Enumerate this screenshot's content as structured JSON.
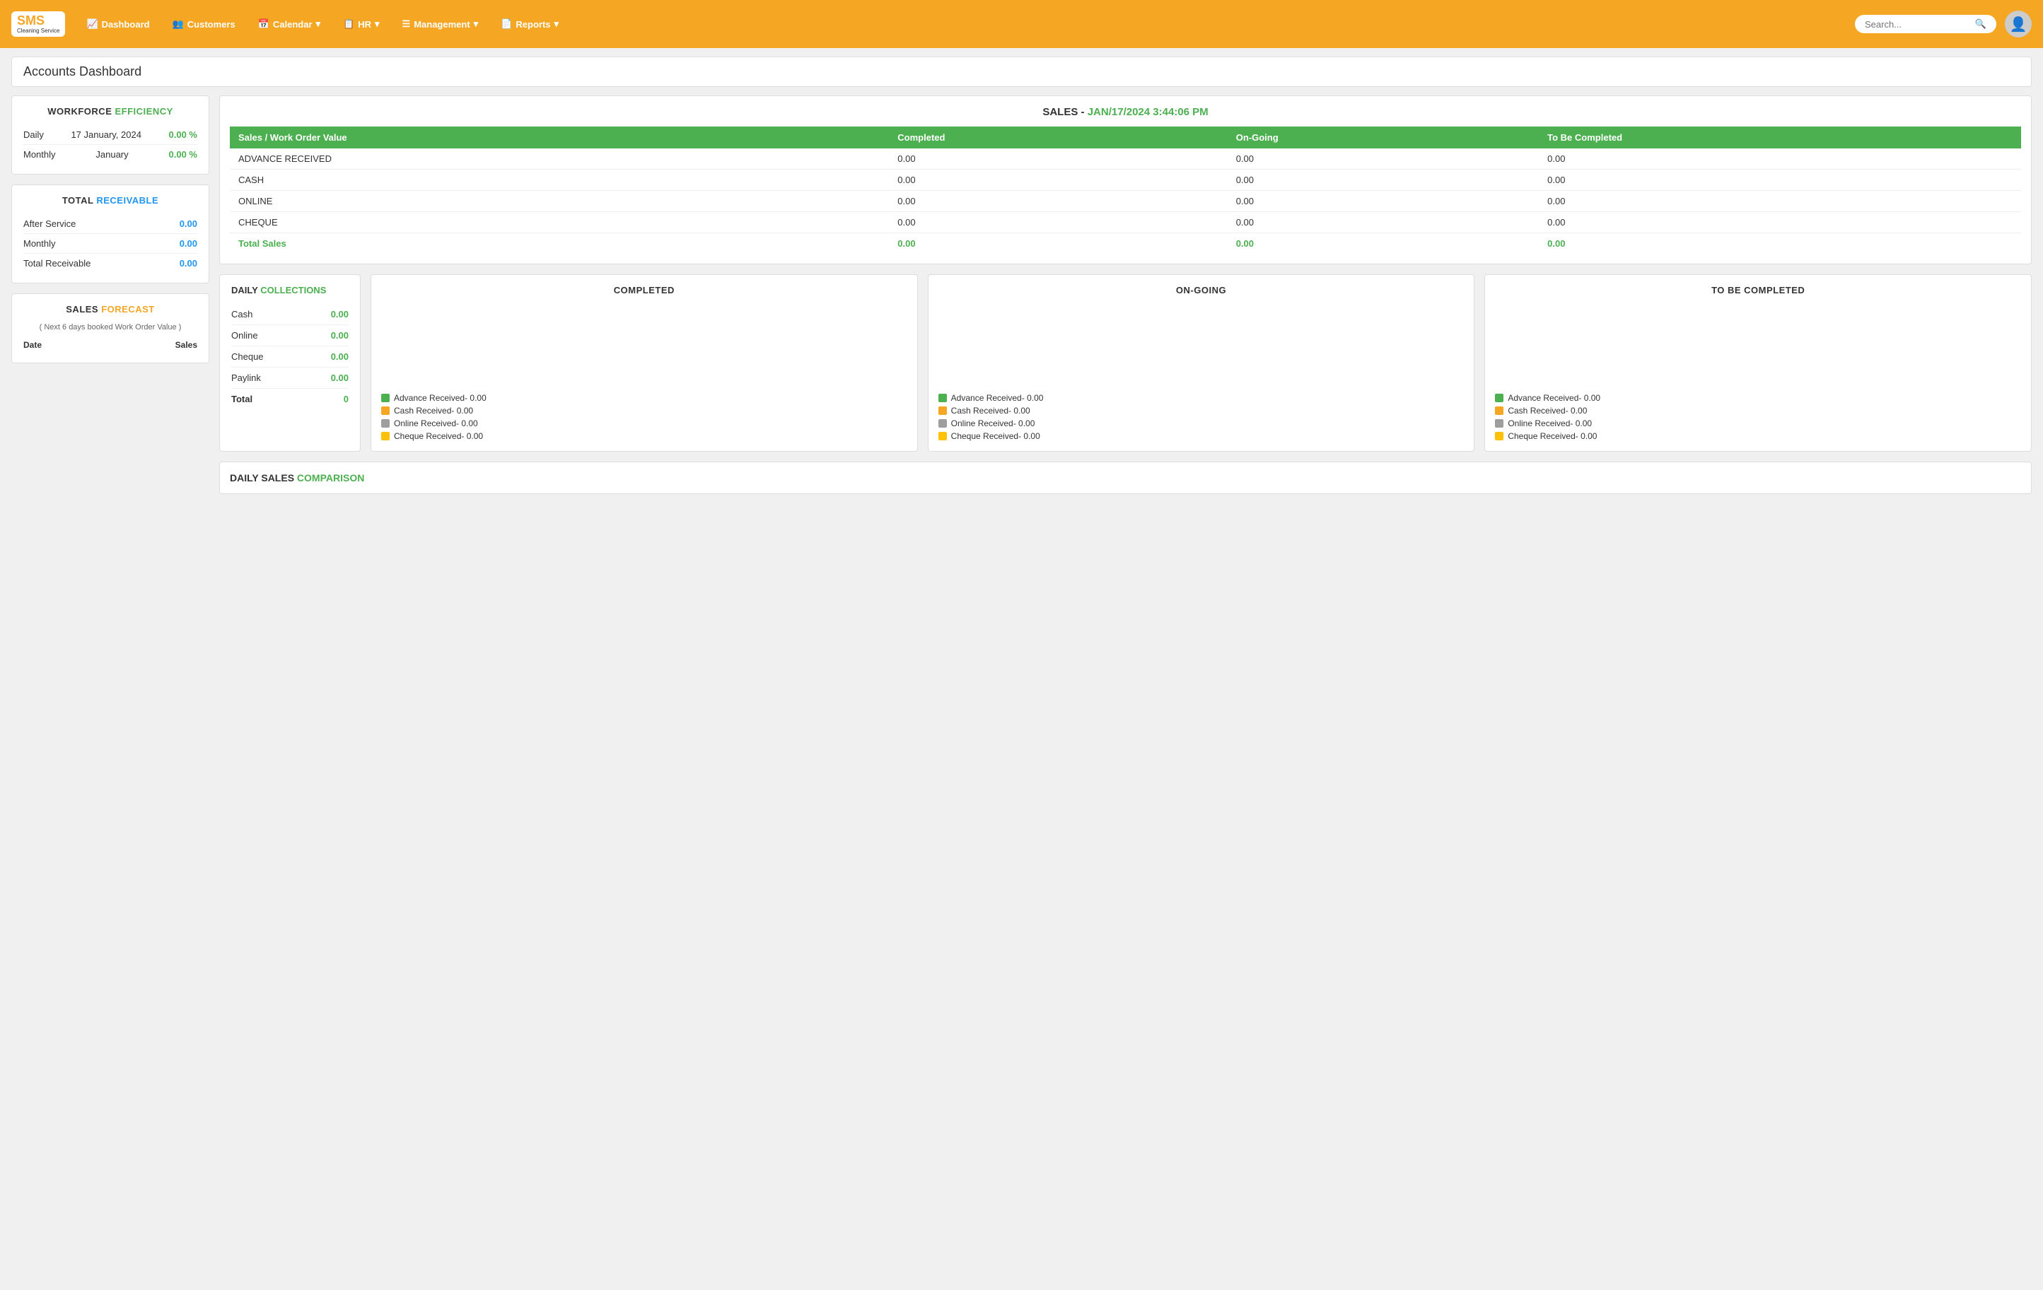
{
  "app": {
    "logo_text": "SMS",
    "logo_sub": "Cleaning Service"
  },
  "navbar": {
    "items": [
      {
        "label": "Dashboard",
        "icon": "📈",
        "has_dropdown": false
      },
      {
        "label": "Customers",
        "icon": "👥",
        "has_dropdown": false
      },
      {
        "label": "Calendar",
        "icon": "📅",
        "has_dropdown": true
      },
      {
        "label": "HR",
        "icon": "📋",
        "has_dropdown": true
      },
      {
        "label": "Management",
        "icon": "☰",
        "has_dropdown": true
      },
      {
        "label": "Reports",
        "icon": "📄",
        "has_dropdown": true
      }
    ],
    "search_placeholder": "Search..."
  },
  "page": {
    "title": "Accounts Dashboard"
  },
  "workforce": {
    "title": "WORKFORCE",
    "highlight": "EFFICIENCY",
    "rows": [
      {
        "label": "Daily",
        "date": "17 January, 2024",
        "value": "0.00 %"
      },
      {
        "label": "Monthly",
        "date": "January",
        "value": "0.00 %"
      }
    ]
  },
  "receivable": {
    "title": "TOTAL",
    "highlight": "RECEIVABLE",
    "rows": [
      {
        "label": "After Service",
        "value": "0.00"
      },
      {
        "label": "Monthly",
        "value": "0.00"
      },
      {
        "label": "Total Receivable",
        "value": "0.00"
      }
    ]
  },
  "forecast": {
    "title": "SALES",
    "highlight": "FORECAST",
    "sub": "( Next 6 days booked Work Order Value )",
    "col_date": "Date",
    "col_sales": "Sales"
  },
  "sales": {
    "title": "SALES -",
    "date": "JAN/17/2024 3:44:06 PM",
    "table": {
      "headers": [
        "Sales / Work Order Value",
        "Completed",
        "On-Going",
        "To Be Completed"
      ],
      "rows": [
        {
          "label": "ADVANCE RECEIVED",
          "completed": "0.00",
          "ongoing": "0.00",
          "to_be": "0.00"
        },
        {
          "label": "CASH",
          "completed": "0.00",
          "ongoing": "0.00",
          "to_be": "0.00"
        },
        {
          "label": "ONLINE",
          "completed": "0.00",
          "ongoing": "0.00",
          "to_be": "0.00"
        },
        {
          "label": "CHEQUE",
          "completed": "0.00",
          "ongoing": "0.00",
          "to_be": "0.00"
        }
      ],
      "total_row": {
        "label": "Total Sales",
        "completed": "0.00",
        "ongoing": "0.00",
        "to_be": "0.00"
      }
    }
  },
  "daily_collections": {
    "title": "DAILY",
    "highlight": "COLLECTIONS",
    "rows": [
      {
        "label": "Cash",
        "value": "0.00"
      },
      {
        "label": "Online",
        "value": "0.00"
      },
      {
        "label": "Cheque",
        "value": "0.00"
      },
      {
        "label": "Paylink",
        "value": "0.00"
      }
    ],
    "total_label": "Total",
    "total_value": "0"
  },
  "status_boxes": [
    {
      "title": "COMPLETED",
      "legend": [
        {
          "color": "green",
          "label": "Advance Received- 0.00"
        },
        {
          "color": "orange",
          "label": "Cash Received- 0.00"
        },
        {
          "color": "gray",
          "label": "Online Received- 0.00"
        },
        {
          "color": "yellow",
          "label": "Cheque Received- 0.00"
        }
      ]
    },
    {
      "title": "ON-GOING",
      "legend": [
        {
          "color": "green",
          "label": "Advance Received- 0.00"
        },
        {
          "color": "orange",
          "label": "Cash Received- 0.00"
        },
        {
          "color": "gray",
          "label": "Online Received- 0.00"
        },
        {
          "color": "yellow",
          "label": "Cheque Received- 0.00"
        }
      ]
    },
    {
      "title": "TO BE COMPLETED",
      "legend": [
        {
          "color": "green",
          "label": "Advance Received- 0.00"
        },
        {
          "color": "orange",
          "label": "Cash Received- 0.00"
        },
        {
          "color": "gray",
          "label": "Online Received- 0.00"
        },
        {
          "color": "yellow",
          "label": "Cheque Received- 0.00"
        }
      ]
    }
  ],
  "daily_comparison": {
    "title": "DAILY SALES",
    "highlight": "COMPARISON"
  }
}
